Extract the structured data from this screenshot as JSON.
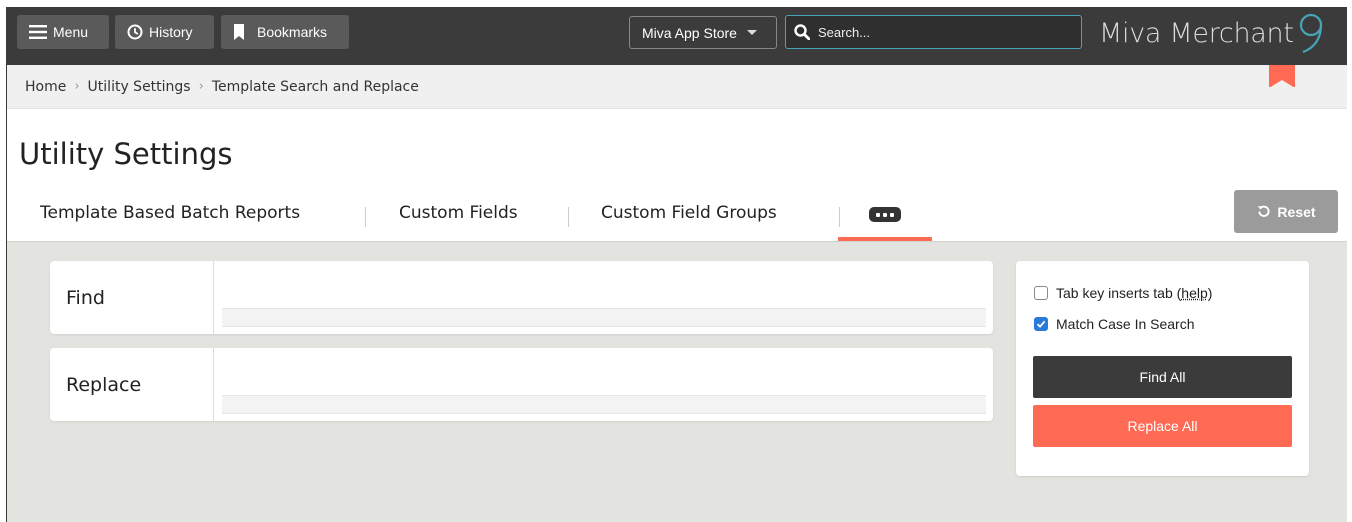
{
  "topbar": {
    "menu_label": "Menu",
    "history_label": "History",
    "bookmarks_label": "Bookmarks",
    "appstore_label": "Miva App Store",
    "search_placeholder": "Search...",
    "brand_text": "Miva Merchant",
    "brand_version": "9"
  },
  "breadcrumb": {
    "items": [
      "Home",
      "Utility Settings",
      "Template Search and Replace"
    ]
  },
  "page": {
    "title": "Utility Settings",
    "reset_label": "Reset"
  },
  "tabs": {
    "items": [
      {
        "label": "Template Based Batch Reports"
      },
      {
        "label": "Custom Fields"
      },
      {
        "label": "Custom Field Groups"
      }
    ]
  },
  "form": {
    "find_label": "Find",
    "find_value": "",
    "replace_label": "Replace",
    "replace_value": ""
  },
  "options": {
    "tab_key_label": "Tab key inserts tab (",
    "tab_key_help": "help",
    "tab_key_close": ")",
    "tab_key_checked": false,
    "match_case_label": "Match Case In Search",
    "match_case_checked": true,
    "find_all_label": "Find All",
    "replace_all_label": "Replace All"
  },
  "colors": {
    "accent": "#ff6a55",
    "topbar": "#3b3b3b",
    "search_border": "#46a6b8",
    "checkbox_on": "#2a7ad9"
  }
}
